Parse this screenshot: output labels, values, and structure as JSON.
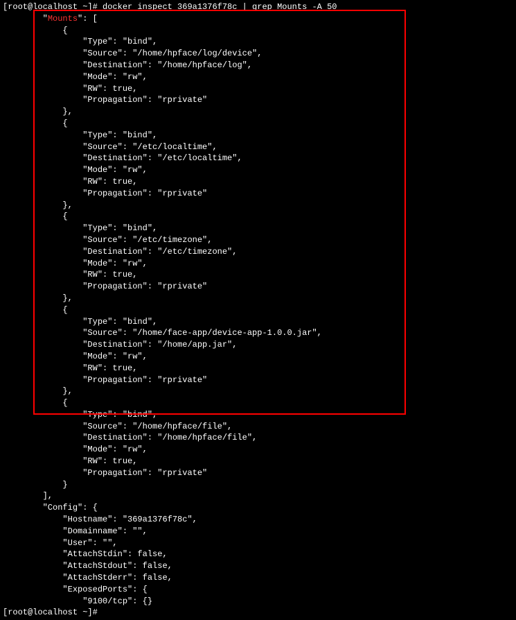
{
  "prompt1": "[root@localhost ~]# docker inspect 369a1376f78c | grep Mounts -A 50",
  "mounts_label": "        \"Mounts\": [",
  "mount1": {
    "open": "            {",
    "type": "                \"Type\": \"bind\",",
    "source": "                \"Source\": \"/home/hpface/log/device\",",
    "dest": "                \"Destination\": \"/home/hpface/log\",",
    "mode": "                \"Mode\": \"rw\",",
    "rw": "                \"RW\": true,",
    "prop": "                \"Propagation\": \"rprivate\"",
    "close": "            },"
  },
  "mount2": {
    "open": "            {",
    "type": "                \"Type\": \"bind\",",
    "source": "                \"Source\": \"/etc/localtime\",",
    "dest": "                \"Destination\": \"/etc/localtime\",",
    "mode": "                \"Mode\": \"rw\",",
    "rw": "                \"RW\": true,",
    "prop": "                \"Propagation\": \"rprivate\"",
    "close": "            },"
  },
  "mount3": {
    "open": "            {",
    "type": "                \"Type\": \"bind\",",
    "source": "                \"Source\": \"/etc/timezone\",",
    "dest": "                \"Destination\": \"/etc/timezone\",",
    "mode": "                \"Mode\": \"rw\",",
    "rw": "                \"RW\": true,",
    "prop": "                \"Propagation\": \"rprivate\"",
    "close": "            },"
  },
  "mount4": {
    "open": "            {",
    "type": "                \"Type\": \"bind\",",
    "source": "                \"Source\": \"/home/face-app/device-app-1.0.0.jar\",",
    "dest": "                \"Destination\": \"/home/app.jar\",",
    "mode": "                \"Mode\": \"rw\",",
    "rw": "                \"RW\": true,",
    "prop": "                \"Propagation\": \"rprivate\"",
    "close": "            },"
  },
  "mount5": {
    "open": "            {",
    "type": "                \"Type\": \"bind\",",
    "source": "                \"Source\": \"/home/hpface/file\",",
    "dest": "                \"Destination\": \"/home/hpface/file\",",
    "mode": "                \"Mode\": \"rw\",",
    "rw": "                \"RW\": true,",
    "prop": "                \"Propagation\": \"rprivate\"",
    "close": "            }"
  },
  "mounts_close": "        ],",
  "config": {
    "open": "        \"Config\": {",
    "hostname": "            \"Hostname\": \"369a1376f78c\",",
    "domainname": "            \"Domainname\": \"\",",
    "user": "            \"User\": \"\",",
    "stdin": "            \"AttachStdin\": false,",
    "stdout": "            \"AttachStdout\": false,",
    "stderr": "            \"AttachStderr\": false,",
    "ports": "            \"ExposedPorts\": {",
    "port1": "                \"9100/tcp\": {}"
  },
  "prompt2": "[root@localhost ~]# "
}
